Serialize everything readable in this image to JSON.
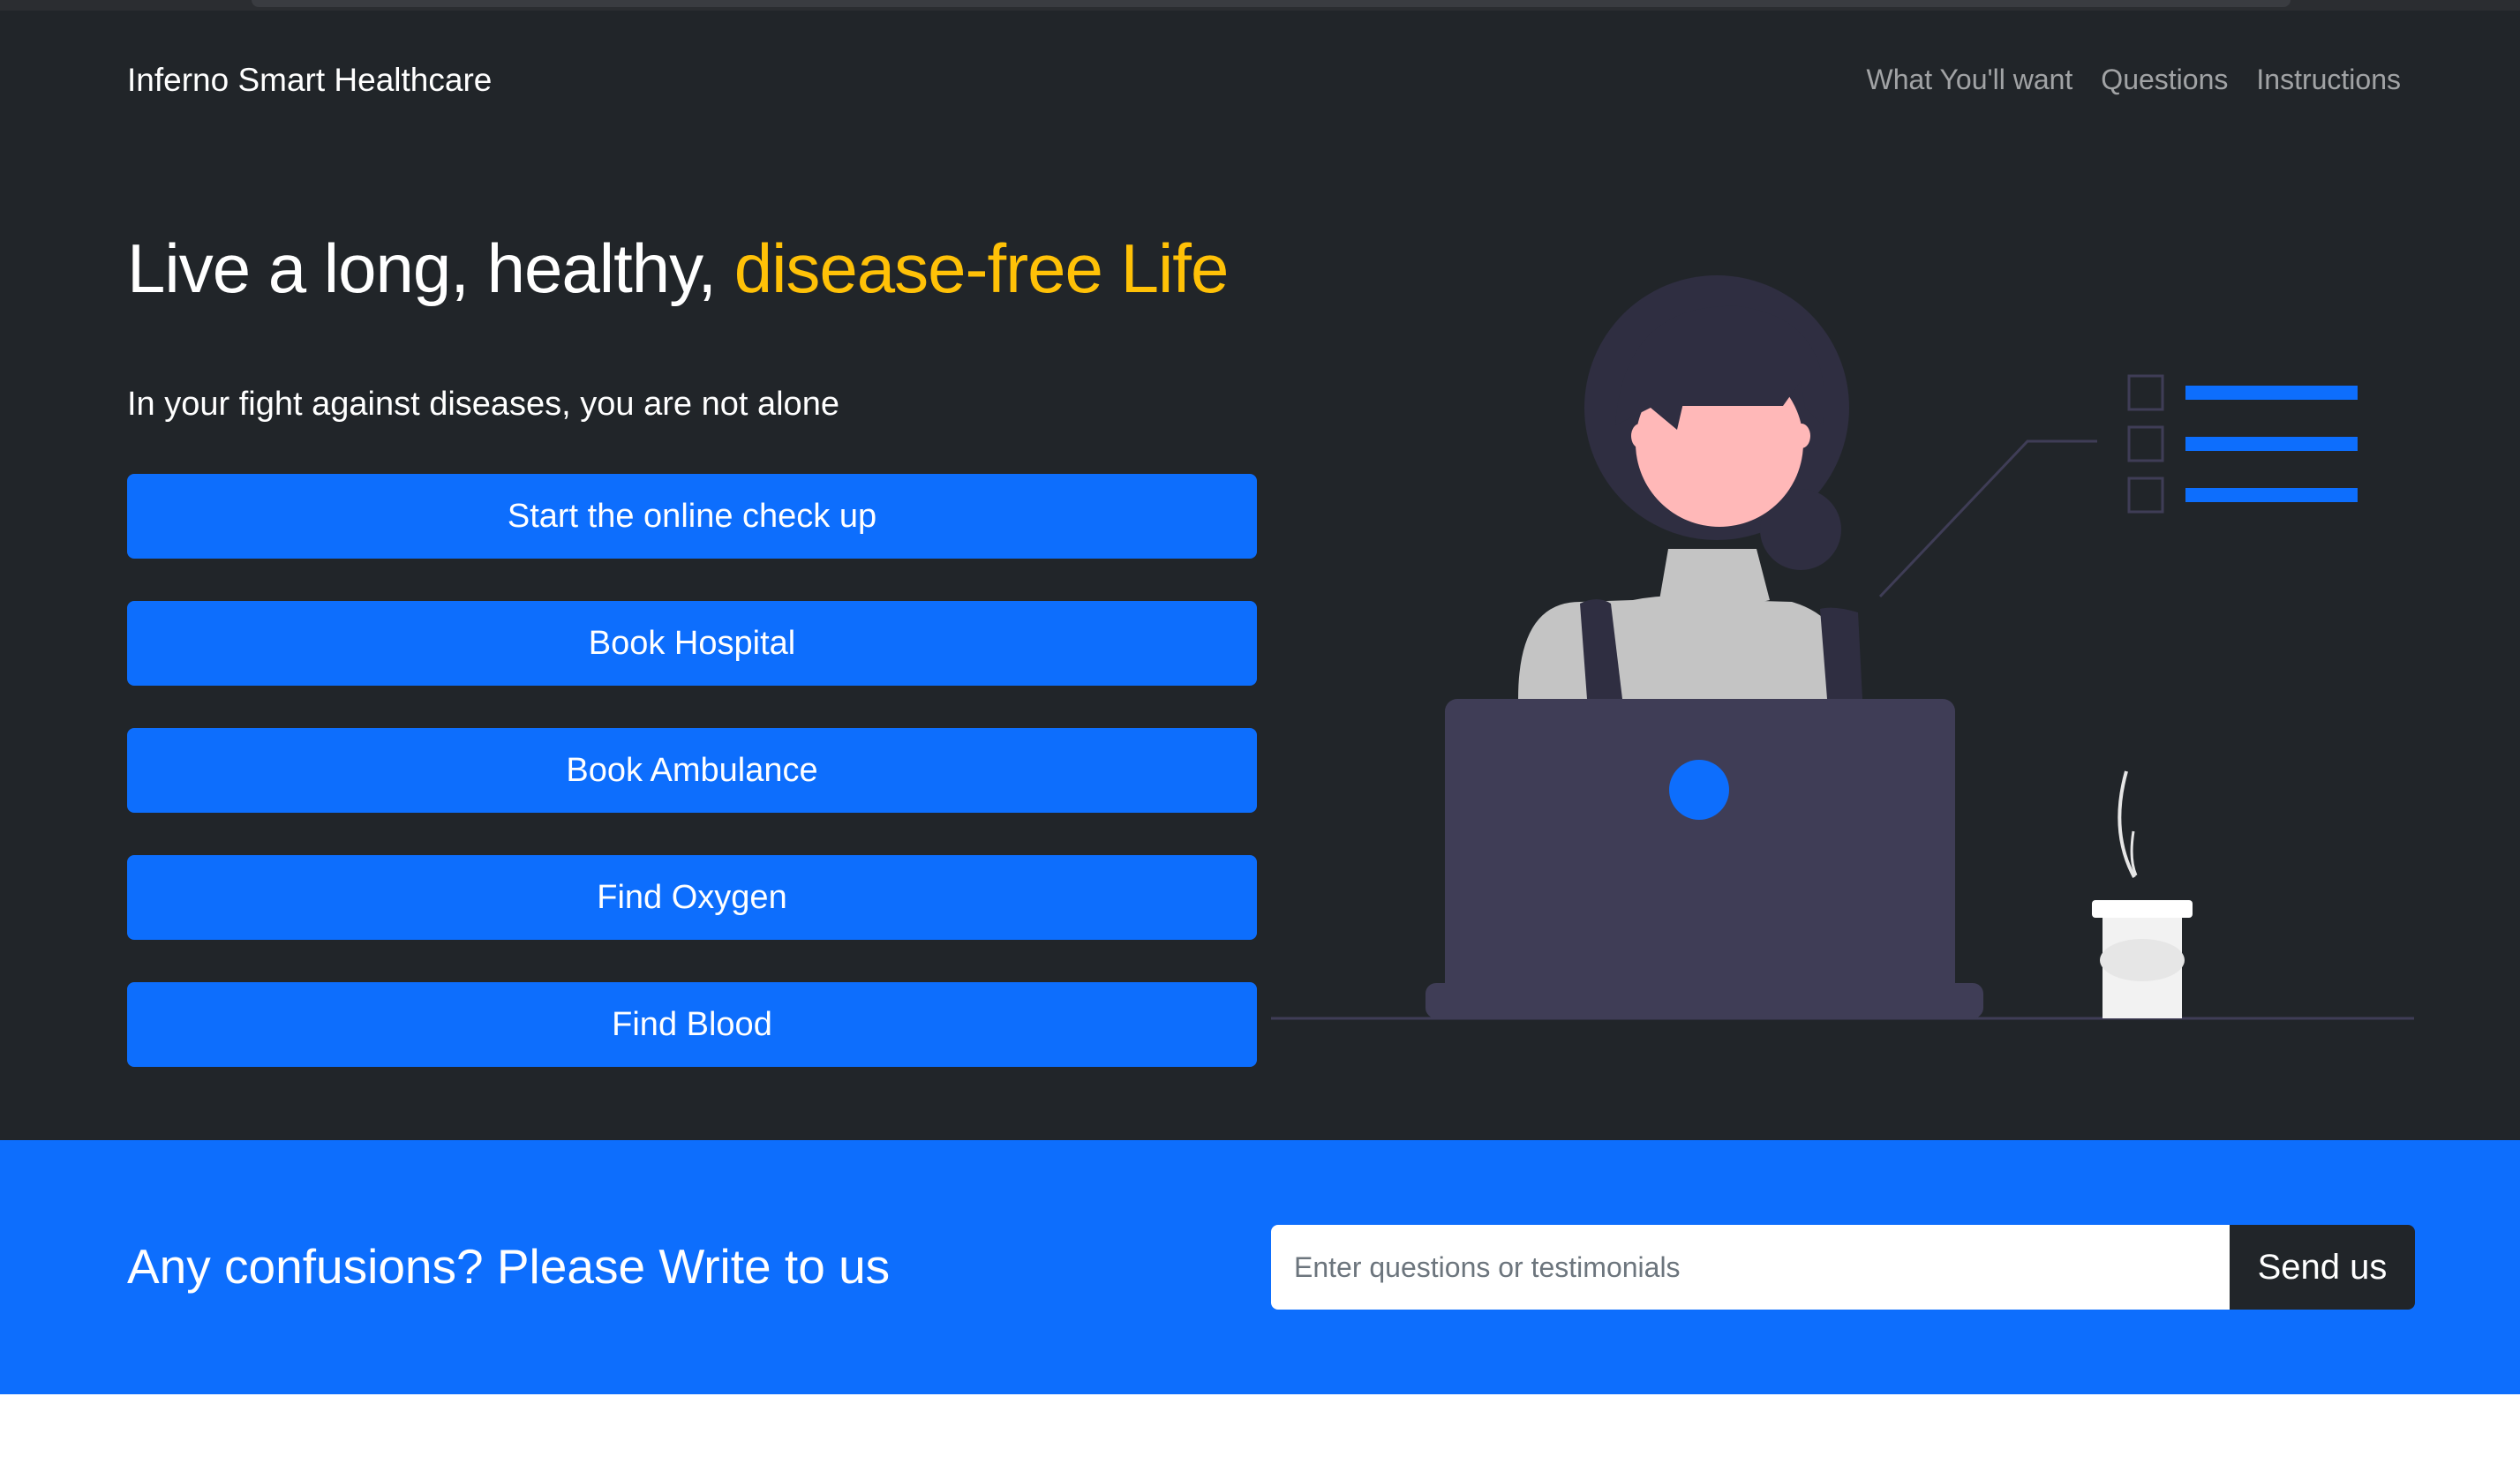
{
  "brand": {
    "name": "Inferno Smart Healthcare"
  },
  "nav": {
    "items": [
      {
        "label": "What You'll want"
      },
      {
        "label": "Questions"
      },
      {
        "label": "Instructions"
      }
    ]
  },
  "hero": {
    "headline_main": "Live a long, healthy, ",
    "headline_accent": "disease-free Life",
    "subtitle": "In your fight against diseases, you are not alone",
    "buttons": [
      {
        "label": "Start the online check up"
      },
      {
        "label": "Book Hospital"
      },
      {
        "label": "Book Ambulance"
      },
      {
        "label": "Find Oxygen"
      },
      {
        "label": "Find Blood"
      }
    ]
  },
  "cta": {
    "title": "Any confusions? Please Write to us",
    "input_placeholder": "Enter questions or testimonials",
    "input_value": "",
    "send_label": "Send us"
  },
  "colors": {
    "dark_bg": "#212529",
    "primary": "#0d6efd",
    "accent": "#ffc107",
    "nav_text": "rgba(255,255,255,0.55)"
  }
}
